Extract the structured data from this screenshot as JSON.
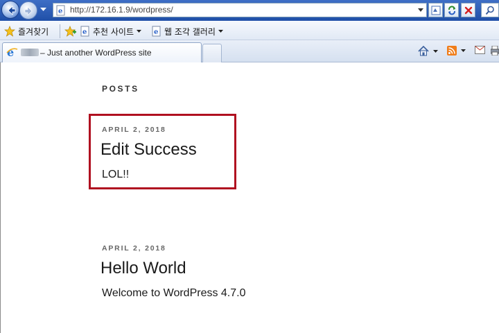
{
  "browser": {
    "url": "http://172.16.1.9/wordpress/",
    "favorites_bar": {
      "favorites_label": "즐겨찾기",
      "suggested_sites_label": "추천 사이트",
      "web_slice_gallery_label": "웹 조각 갤러리"
    },
    "tab": {
      "title": "– Just another WordPress site"
    },
    "icons": {
      "back": "back-arrow-icon",
      "forward": "forward-arrow-icon",
      "page": "ie-page-icon",
      "compat": "compatibility-view-icon",
      "refresh": "refresh-icon",
      "stop": "stop-icon",
      "search": "search-icon",
      "home": "home-icon",
      "feeds": "rss-feed-icon",
      "mail": "mail-icon",
      "print": "print-icon"
    },
    "colors": {
      "chrome_blue": "#1f4fa8",
      "highlight_red": "#b01020",
      "rss_orange": "#f07d1a"
    }
  },
  "page": {
    "section_heading": "POSTS",
    "posts": [
      {
        "date": "APRIL 2, 2018",
        "title": "Edit Success",
        "excerpt": "LOL!!"
      },
      {
        "date": "APRIL 2, 2018",
        "title": "Hello World",
        "excerpt": "Welcome to WordPress 4.7.0"
      }
    ]
  }
}
